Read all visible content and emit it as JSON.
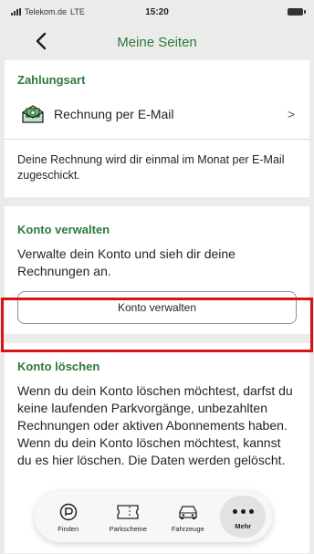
{
  "status_bar": {
    "carrier": "Telekom.de",
    "network": "LTE",
    "time": "15:20",
    "icons": [
      "signal-icon",
      "battery-icon"
    ]
  },
  "header": {
    "back_icon": "chevron-left-icon",
    "title": "Meine Seiten"
  },
  "payment": {
    "heading": "Zahlungsart",
    "method_icon": "envelope-money-icon",
    "method_label": "Rechnung per E-Mail",
    "description": "Deine Rechnung wird dir einmal im Monat per E-Mail zugeschickt."
  },
  "account": {
    "heading": "Konto verwalten",
    "description": "Verwalte dein Konto und sieh dir deine Rechnungen an.",
    "button_label": "Konto verwalten",
    "highlight_color": "#d81418"
  },
  "delete": {
    "heading": "Konto löschen",
    "description": "Wenn du dein Konto löschen möchtest, darfst du keine laufenden Parkvorgänge, unbezahlten Rechnungen oder aktiven Abonnements haben. Wenn du dein Konto löschen möchtest, kannst du es hier löschen. Die Daten werden gelöscht."
  },
  "tabs": [
    {
      "label": "Finden",
      "icon": "parking-search-icon"
    },
    {
      "label": "Parkscheine",
      "icon": "ticket-icon"
    },
    {
      "label": "Fahrzeuge",
      "icon": "car-icon"
    },
    {
      "label": "Mehr",
      "icon": "more-dots-icon"
    }
  ],
  "colors": {
    "accent": "#2c7a3d",
    "background": "#ebecea",
    "card": "#ffffff"
  }
}
